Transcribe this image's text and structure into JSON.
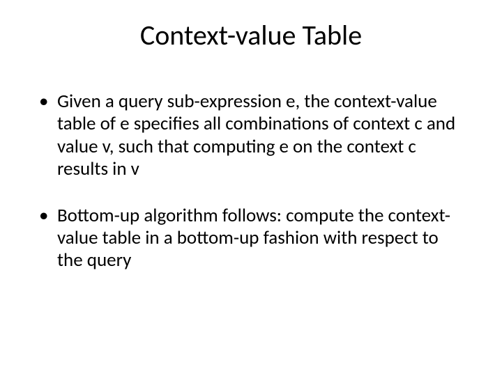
{
  "slide": {
    "title": "Context-value Table",
    "bullets": [
      "Given a query sub-expression e, the context-value table of e specifies all combinations of context c and value v, such that computing e on the context c results in v",
      "Bottom-up algorithm follows: compute the context-value table in a bottom-up fashion with respect to the query"
    ]
  }
}
